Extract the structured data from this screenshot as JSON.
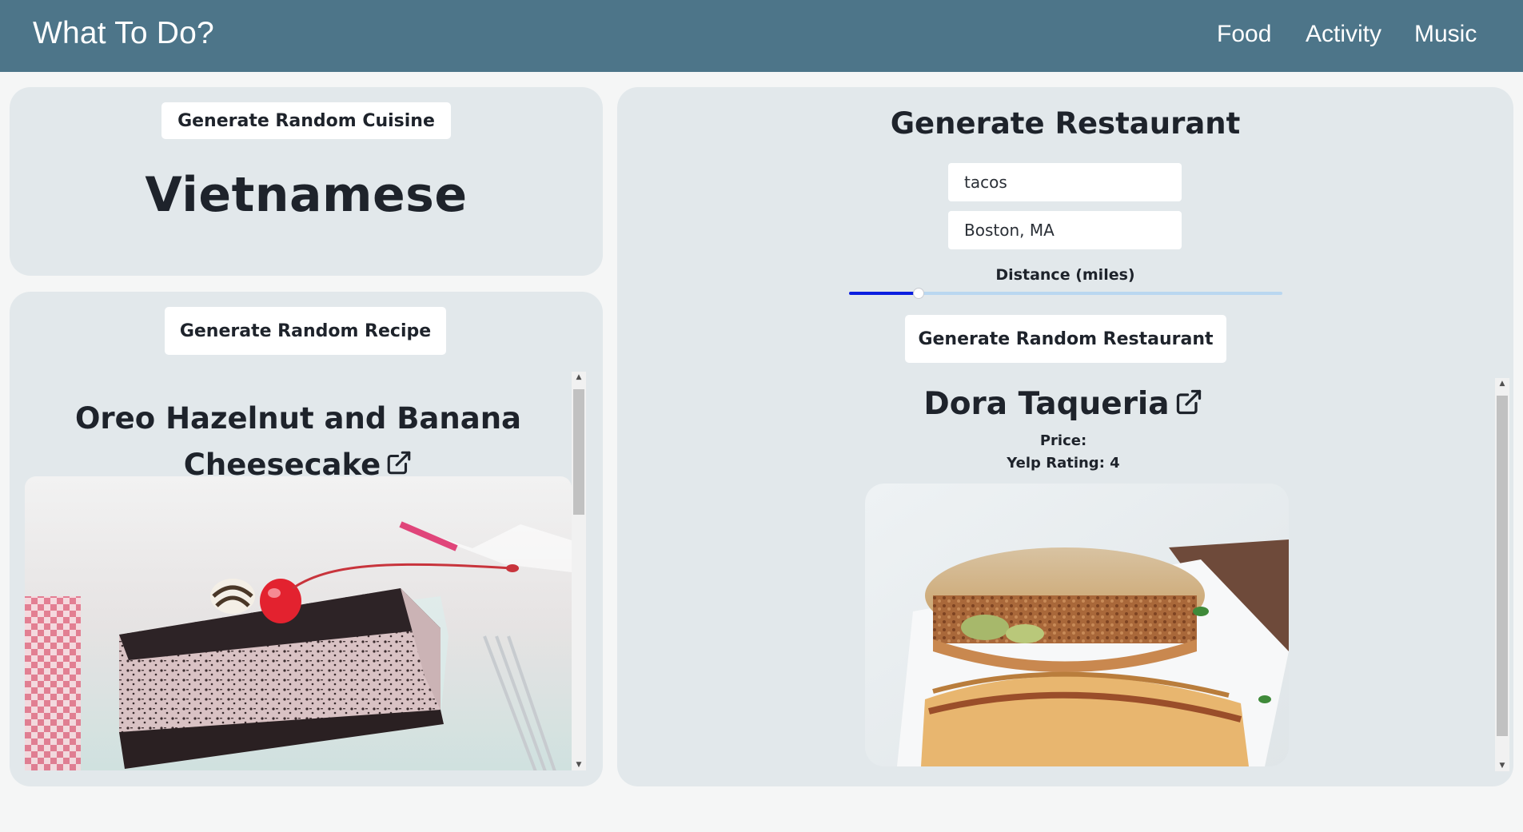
{
  "app": {
    "brand": "What To Do?"
  },
  "nav": {
    "items": [
      {
        "label": "Food"
      },
      {
        "label": "Activity"
      },
      {
        "label": "Music"
      }
    ]
  },
  "cuisine": {
    "button_label": "Generate Random Cuisine",
    "result": "Vietnamese"
  },
  "recipe": {
    "button_label": "Generate Random Recipe",
    "title_line1": "Oreo Hazelnut and Banana",
    "title_line2": "Cheesecake",
    "external_icon": "external-link-icon",
    "image_subject": "Oreo cheesecake slice photo"
  },
  "restaurant": {
    "heading": "Generate Restaurant",
    "search_value": "tacos",
    "location_value": "Boston, MA",
    "distance_label": "Distance (miles)",
    "distance_fraction": 0.16,
    "button_label": "Generate Random Restaurant",
    "result_name": "Dora Taqueria",
    "price_label": "Price:",
    "rating_label": "Yelp Rating: 4",
    "external_icon": "external-link-icon",
    "image_subject": "torta sandwich photo"
  },
  "colors": {
    "navbar": "#4d7589",
    "card": "#e2e8eb",
    "slider_fill": "#0b1fe0",
    "slider_track": "#b9d7f0"
  }
}
